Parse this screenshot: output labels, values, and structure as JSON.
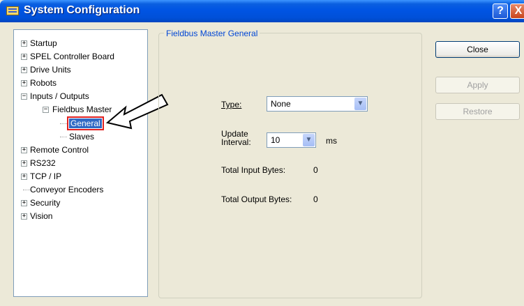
{
  "window": {
    "title": "System Configuration",
    "help_label": "?",
    "close_label": "X"
  },
  "tree": {
    "items": [
      {
        "label": "Startup",
        "expander": "+"
      },
      {
        "label": "SPEL Controller Board",
        "expander": "+"
      },
      {
        "label": "Drive Units",
        "expander": "+"
      },
      {
        "label": "Robots",
        "expander": "+"
      },
      {
        "label": "Inputs / Outputs",
        "expander": "−"
      },
      {
        "label": "Fieldbus Master",
        "expander": "−"
      },
      {
        "label": "General"
      },
      {
        "label": "Slaves"
      },
      {
        "label": "Remote Control",
        "expander": "+"
      },
      {
        "label": "RS232",
        "expander": "+"
      },
      {
        "label": "TCP / IP",
        "expander": "+"
      },
      {
        "label": "Conveyor Encoders"
      },
      {
        "label": "Security",
        "expander": "+"
      },
      {
        "label": "Vision",
        "expander": "+"
      }
    ]
  },
  "panel": {
    "legend": "Fieldbus Master General",
    "type_label": "Type:",
    "type_value": "None",
    "update_label_line1": "Update",
    "update_label_line2": "Interval:",
    "update_value": "10",
    "update_unit": "ms",
    "input_bytes_label": "Total Input Bytes:",
    "input_bytes_value": "0",
    "output_bytes_label": "Total Output Bytes:",
    "output_bytes_value": "0"
  },
  "buttons": {
    "close": "Close",
    "apply": "Apply",
    "restore": "Restore"
  }
}
